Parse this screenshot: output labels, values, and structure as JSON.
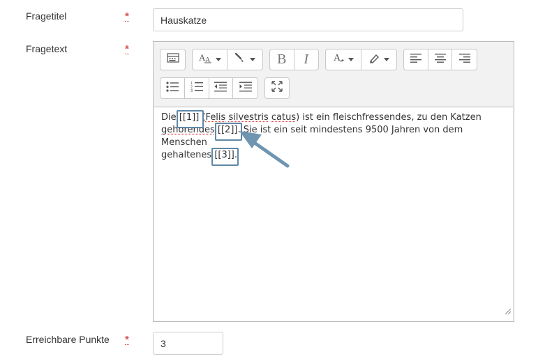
{
  "fields": {
    "title": {
      "label": "Fragetitel",
      "value": "Hauskatze"
    },
    "text": {
      "label": "Fragetext"
    },
    "points": {
      "label": "Erreichbare Punkte",
      "value": "3"
    },
    "required_marker": "*"
  },
  "toolbar": {
    "row1": [
      [
        "toolbar-toggle-icon"
      ],
      [
        "font-size-icon",
        "font-color-icon"
      ],
      [
        "bold-icon",
        "italic-icon"
      ],
      [
        "text-color-icon",
        "highlight-icon"
      ],
      [
        "align-left-icon",
        "align-center-icon",
        "align-right-icon"
      ]
    ],
    "row2": [
      [
        "bullet-list-icon",
        "numbered-list-icon",
        "outdent-icon",
        "indent-icon"
      ],
      [
        "fullscreen-icon"
      ]
    ]
  },
  "content": {
    "line1_a": "Die ",
    "gap1": "[[1]]",
    "line1_b": " (",
    "spell1": "Felis",
    "sp1": " ",
    "spell2": "silvestris",
    "sp2": " ",
    "spell3": "catus",
    "line1_c": ") ist ein fleischfressendes, zu den Katzen",
    "spell4": "gehorendes",
    "sp3": " ",
    "gap2": "[[2]]",
    "line2_b": ". Sie ist ein seit mindestens 9500 Jahren von dem Menschen",
    "line3_a": "gehaltenes ",
    "gap3": "[[3]]",
    "line3_b": "."
  },
  "colors": {
    "accent_box": "#5f88a8",
    "required": "#d9534f"
  }
}
